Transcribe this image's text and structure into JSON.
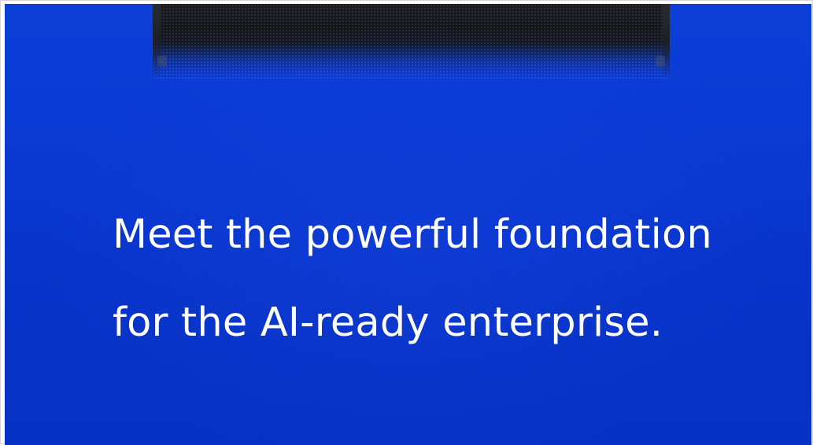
{
  "banner": {
    "background_color": "#0a39d4",
    "text_color": "#ffffff",
    "image": {
      "name": "server-hardware-image"
    },
    "headline": {
      "line1": "Meet the powerful foundation",
      "line2": "for the AI-ready enterprise."
    }
  }
}
